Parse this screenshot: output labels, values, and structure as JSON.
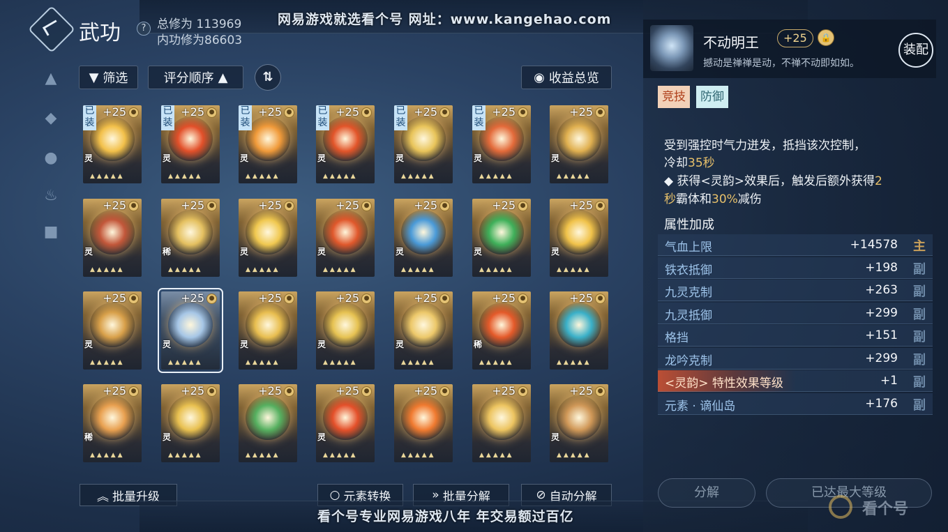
{
  "header": {
    "title": "武功",
    "cultivation_total": "总修为 113969",
    "cultivation_inner": "内功修为86603"
  },
  "banner_top": "网易游戏就选看个号  网址：www.kangehao.com",
  "banner_bottom": "看个号专业网易游戏八年  年交易额过百亿",
  "toolbar": {
    "filter_label": "筛选",
    "sort_label": "评分顺序",
    "income_label": "收益总览"
  },
  "cards": [
    {
      "plus": "+25",
      "equipped": "已装",
      "grade": "灵",
      "art": "#f2c04a"
    },
    {
      "plus": "+25",
      "equipped": "已装",
      "grade": "灵",
      "art": "#e2502a"
    },
    {
      "plus": "+25",
      "equipped": "已装",
      "grade": "灵",
      "art": "#f09a3a"
    },
    {
      "plus": "+25",
      "equipped": "已装",
      "grade": "灵",
      "art": "#e2552a"
    },
    {
      "plus": "+25",
      "equipped": "已装",
      "grade": "灵",
      "art": "#e8c45a"
    },
    {
      "plus": "+25",
      "equipped": "已装",
      "grade": "灵",
      "art": "#e36a3a"
    },
    {
      "plus": "+25",
      "equipped": "",
      "grade": "灵",
      "art": "#e0b050"
    },
    {
      "plus": "+25",
      "equipped": "",
      "grade": "灵",
      "art": "#c2573a"
    },
    {
      "plus": "+25",
      "equipped": "",
      "grade": "稀",
      "art": "#e4c060"
    },
    {
      "plus": "+25",
      "equipped": "",
      "grade": "灵",
      "art": "#f0c850"
    },
    {
      "plus": "+25",
      "equipped": "",
      "grade": "灵",
      "art": "#e0582c"
    },
    {
      "plus": "+25",
      "equipped": "",
      "grade": "灵",
      "art": "#4a9ad8"
    },
    {
      "plus": "+25",
      "equipped": "",
      "grade": "灵",
      "art": "#3fb05a"
    },
    {
      "plus": "+25",
      "equipped": "",
      "grade": "灵",
      "art": "#f0c24a"
    },
    {
      "plus": "+25",
      "equipped": "",
      "grade": "灵",
      "art": "#d8a04a"
    },
    {
      "plus": "+25",
      "equipped": "",
      "grade": "灵",
      "art": "#a6c6e6"
    },
    {
      "plus": "+25",
      "equipped": "",
      "grade": "灵",
      "art": "#e8be50"
    },
    {
      "plus": "+25",
      "equipped": "",
      "grade": "灵",
      "art": "#e6c252"
    },
    {
      "plus": "+25",
      "equipped": "",
      "grade": "灵",
      "art": "#ecc86a"
    },
    {
      "plus": "+25",
      "equipped": "",
      "grade": "稀",
      "art": "#e45a2a"
    },
    {
      "plus": "+25",
      "equipped": "",
      "grade": "",
      "art": "#3ab0c8"
    },
    {
      "plus": "+25",
      "equipped": "",
      "grade": "稀",
      "art": "#e8a050"
    },
    {
      "plus": "+25",
      "equipped": "",
      "grade": "灵",
      "art": "#e8c050"
    },
    {
      "plus": "+25",
      "equipped": "",
      "grade": "",
      "art": "#56b060"
    },
    {
      "plus": "+25",
      "equipped": "",
      "grade": "灵",
      "art": "#e4502a"
    },
    {
      "plus": "+25",
      "equipped": "",
      "grade": "",
      "art": "#f07a30"
    },
    {
      "plus": "+25",
      "equipped": "",
      "grade": "",
      "art": "#ecc460"
    },
    {
      "plus": "+25",
      "equipped": "",
      "grade": "灵",
      "art": "#d09858"
    }
  ],
  "bottom_buttons": {
    "batch_upgrade": "批量升级",
    "element_convert": "元素转换",
    "batch_decompose": "批量分解",
    "auto_decompose": "自动分解"
  },
  "detail": {
    "name": "不动明王",
    "plus": "+25",
    "subtitle": "撼动是禅禅是动，不禅不动即如如。",
    "equip_label": "装配",
    "tags": [
      "竞技",
      "防御"
    ],
    "desc_line1": "受到强控时气力迸发，抵挡该次控制，",
    "desc_line2_prefix": "冷却",
    "desc_line2_value": "35秒",
    "desc_line3_prefix": "◆ 获得<灵韵>效果后，触发后额外获得",
    "desc_line3_value": "2",
    "desc_line4_value1": "秒",
    "desc_line4_mid": "霸体和",
    "desc_line4_value2": "30%",
    "desc_line4_suffix": "减伤",
    "attr_title": "属性加成",
    "attributes": [
      {
        "name": "气血上限",
        "value": "+14578",
        "kind": "主"
      },
      {
        "name": "铁衣抵御",
        "value": "+198",
        "kind": "副"
      },
      {
        "name": "九灵克制",
        "value": "+263",
        "kind": "副"
      },
      {
        "name": "九灵抵御",
        "value": "+299",
        "kind": "副"
      },
      {
        "name": "格挡",
        "value": "+151",
        "kind": "副"
      },
      {
        "name": "龙吟克制",
        "value": "+299",
        "kind": "副"
      },
      {
        "name": "<灵韵> 特性效果等级",
        "value": "+1",
        "kind": "副"
      },
      {
        "name": "元素 · 谪仙岛",
        "value": "+176",
        "kind": "副"
      }
    ],
    "decompose_label": "分解",
    "max_level_label": "已达最大等级"
  },
  "watermark": "看个号",
  "colors": {
    "gold": "#e7c06a",
    "tag_pvp": "#e8a070",
    "tag_def": "#a8dce6",
    "attr_blue": "#9ec4ea"
  }
}
